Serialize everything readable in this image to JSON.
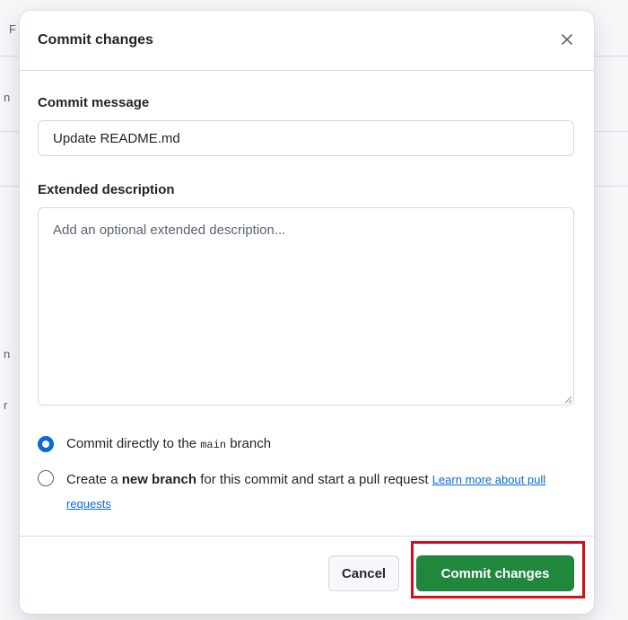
{
  "background": {
    "fragments": [
      "F",
      "n",
      "n",
      "r"
    ]
  },
  "dialog": {
    "title": "Commit changes",
    "close_icon": "close-icon"
  },
  "commit_message": {
    "label": "Commit message",
    "value": "Update README.md"
  },
  "extended_description": {
    "label": "Extended description",
    "placeholder": "Add an optional extended description..."
  },
  "branch_options": {
    "direct": {
      "prefix": "Commit directly to the ",
      "branch": "main",
      "suffix": " branch",
      "selected": true
    },
    "new_branch": {
      "prefix": "Create a ",
      "bold": "new branch",
      "suffix": " for this commit and start a pull request ",
      "link": "Learn more about pull requests",
      "selected": false
    }
  },
  "footer": {
    "cancel_label": "Cancel",
    "commit_label": "Commit changes"
  },
  "colors": {
    "primary_button": "#1f883d",
    "radio_accent": "#0969da",
    "highlight_border": "#d0101e",
    "link": "#0969da"
  }
}
